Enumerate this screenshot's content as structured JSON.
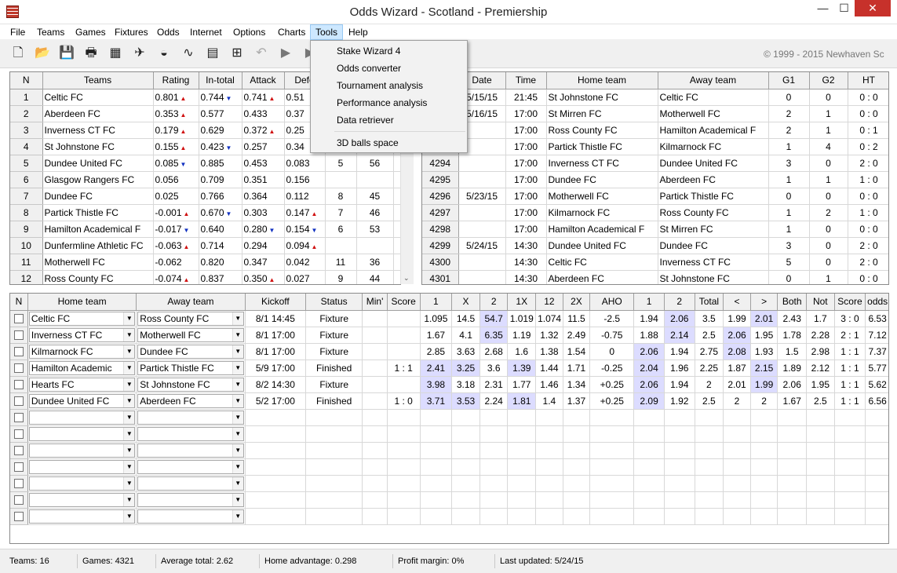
{
  "window": {
    "title": "Odds Wizard - Scotland - Premiership",
    "min": "—",
    "max": "☐",
    "close": "✕"
  },
  "menu": [
    "File",
    "Teams",
    "Games",
    "Fixtures",
    "Odds",
    "Internet",
    "Options",
    "Charts",
    "Tools",
    "Help"
  ],
  "tools_menu": [
    "Stake Wizard 4",
    "Odds converter",
    "Tournament analysis",
    "Performance analysis",
    "Data retriever",
    "3D balls space"
  ],
  "copyright": "© 1999 - 2015 Newhaven Sc",
  "teams_table": {
    "headers": [
      "N",
      "Teams",
      "Rating",
      "In-total",
      "Attack",
      "Defe"
    ],
    "rows": [
      {
        "n": "1",
        "team": "Celtic FC",
        "rating": "0.801",
        "r_ind": "up",
        "intotal": "0.744",
        "i_ind": "dn",
        "attack": "0.741",
        "a_ind": "up",
        "def": "0.51",
        "d_ind": "",
        "x": "",
        "y": ""
      },
      {
        "n": "2",
        "team": "Aberdeen FC",
        "rating": "0.353",
        "r_ind": "up",
        "intotal": "0.577",
        "i_ind": "",
        "attack": "0.433",
        "a_ind": "",
        "def": "0.37",
        "d_ind": "",
        "x": "",
        "y": ""
      },
      {
        "n": "3",
        "team": "Inverness CT FC",
        "rating": "0.179",
        "r_ind": "up",
        "intotal": "0.629",
        "i_ind": "",
        "attack": "0.372",
        "a_ind": "up",
        "def": "0.25",
        "d_ind": "",
        "x": "",
        "y": ""
      },
      {
        "n": "4",
        "team": "St Johnstone FC",
        "rating": "0.155",
        "r_ind": "up",
        "intotal": "0.423",
        "i_ind": "dn",
        "attack": "0.257",
        "a_ind": "",
        "def": "0.34",
        "d_ind": "",
        "x": "",
        "y": ""
      },
      {
        "n": "5",
        "team": "Dundee United FC",
        "rating": "0.085",
        "r_ind": "dn",
        "intotal": "0.885",
        "i_ind": "",
        "attack": "0.453",
        "a_ind": "",
        "def": "0.083",
        "d_ind": "",
        "x": "5",
        "y": "56"
      },
      {
        "n": "6",
        "team": "Glasgow Rangers FC",
        "rating": "0.056",
        "r_ind": "",
        "intotal": "0.709",
        "i_ind": "",
        "attack": "0.351",
        "a_ind": "",
        "def": "0.156",
        "d_ind": "",
        "x": "",
        "y": ""
      },
      {
        "n": "7",
        "team": "Dundee FC",
        "rating": "0.025",
        "r_ind": "",
        "intotal": "0.766",
        "i_ind": "",
        "attack": "0.364",
        "a_ind": "",
        "def": "0.112",
        "d_ind": "",
        "x": "8",
        "y": "45"
      },
      {
        "n": "8",
        "team": "Partick Thistle FC",
        "rating": "-0.001",
        "r_ind": "up",
        "intotal": "0.670",
        "i_ind": "dn",
        "attack": "0.303",
        "a_ind": "",
        "def": "0.147",
        "d_ind": "up",
        "x": "7",
        "y": "46"
      },
      {
        "n": "9",
        "team": "Hamilton Academical F",
        "rating": "-0.017",
        "r_ind": "dn",
        "intotal": "0.640",
        "i_ind": "",
        "attack": "0.280",
        "a_ind": "dn",
        "def": "0.154",
        "d_ind": "dn",
        "x": "6",
        "y": "53"
      },
      {
        "n": "10",
        "team": "Dunfermline Athletic FC",
        "rating": "-0.063",
        "r_ind": "up",
        "intotal": "0.714",
        "i_ind": "",
        "attack": "0.294",
        "a_ind": "",
        "def": "0.094",
        "d_ind": "up",
        "x": "",
        "y": ""
      },
      {
        "n": "11",
        "team": "Motherwell FC",
        "rating": "-0.062",
        "r_ind": "",
        "intotal": "0.820",
        "i_ind": "",
        "attack": "0.347",
        "a_ind": "",
        "def": "0.042",
        "d_ind": "",
        "x": "11",
        "y": "36"
      },
      {
        "n": "12",
        "team": "Ross County FC",
        "rating": "-0.074",
        "r_ind": "up",
        "intotal": "0.837",
        "i_ind": "",
        "attack": "0.350",
        "a_ind": "up",
        "def": "0.027",
        "d_ind": "",
        "x": "9",
        "y": "44"
      }
    ]
  },
  "games_table": {
    "headers": [
      "",
      "Date",
      "Time",
      "Home team",
      "Away team",
      "G1",
      "G2",
      "HT"
    ],
    "rows": [
      {
        "n": "",
        "date": "5/15/15",
        "time": "21:45",
        "home": "St Johnstone FC",
        "away": "Celtic FC",
        "g1": "0",
        "g2": "0",
        "ht": "0 : 0"
      },
      {
        "n": "",
        "date": "5/16/15",
        "time": "17:00",
        "home": "St Mirren FC",
        "away": "Motherwell FC",
        "g1": "2",
        "g2": "1",
        "ht": "0 : 0"
      },
      {
        "n": "",
        "date": "",
        "time": "17:00",
        "home": "Ross County FC",
        "away": "Hamilton Academical F",
        "g1": "2",
        "g2": "1",
        "ht": "0 : 1"
      },
      {
        "n": "",
        "date": "",
        "time": "17:00",
        "home": "Partick Thistle FC",
        "away": "Kilmarnock FC",
        "g1": "1",
        "g2": "4",
        "ht": "0 : 2"
      },
      {
        "n": "4294",
        "date": "",
        "time": "17:00",
        "home": "Inverness CT FC",
        "away": "Dundee United FC",
        "g1": "3",
        "g2": "0",
        "ht": "2 : 0"
      },
      {
        "n": "4295",
        "date": "",
        "time": "17:00",
        "home": "Dundee FC",
        "away": "Aberdeen FC",
        "g1": "1",
        "g2": "1",
        "ht": "1 : 0"
      },
      {
        "n": "4296",
        "date": "5/23/15",
        "time": "17:00",
        "home": "Motherwell FC",
        "away": "Partick Thistle FC",
        "g1": "0",
        "g2": "0",
        "ht": "0 : 0"
      },
      {
        "n": "4297",
        "date": "",
        "time": "17:00",
        "home": "Kilmarnock FC",
        "away": "Ross County FC",
        "g1": "1",
        "g2": "2",
        "ht": "1 : 0"
      },
      {
        "n": "4298",
        "date": "",
        "time": "17:00",
        "home": "Hamilton Academical F",
        "away": "St Mirren FC",
        "g1": "1",
        "g2": "0",
        "ht": "0 : 0"
      },
      {
        "n": "4299",
        "date": "5/24/15",
        "time": "14:30",
        "home": "Dundee United FC",
        "away": "Dundee FC",
        "g1": "3",
        "g2": "0",
        "ht": "2 : 0"
      },
      {
        "n": "4300",
        "date": "",
        "time": "14:30",
        "home": "Celtic FC",
        "away": "Inverness CT FC",
        "g1": "5",
        "g2": "0",
        "ht": "2 : 0"
      },
      {
        "n": "4301",
        "date": "",
        "time": "14:30",
        "home": "Aberdeen FC",
        "away": "St Johnstone FC",
        "g1": "0",
        "g2": "1",
        "ht": "0 : 0"
      }
    ]
  },
  "fixtures_table": {
    "headers": [
      "N",
      "Home team",
      "Away team",
      "Kickoff",
      "Status",
      "Min'",
      "Score",
      "1",
      "X",
      "2",
      "1X",
      "12",
      "2X",
      "AHO",
      "1",
      "2",
      "Total",
      "<",
      ">",
      "Both",
      "Not",
      "Score",
      "odds"
    ],
    "rows": [
      {
        "home": "Celtic FC",
        "away": "Ross County FC",
        "kickoff": "8/1 14:45",
        "status": "Fixture",
        "min": "",
        "score": "",
        "c1": "1.095",
        "cx": "14.5",
        "c2": "54.7",
        "c1x": "1.019",
        "c12": "1.074",
        "c2x": "11.5",
        "aho": "-2.5",
        "h1": "1.94",
        "h2": "2.06",
        "total": "3.5",
        "lt": "1.99",
        "gt": "2.01",
        "both": "2.43",
        "not": "1.7",
        "score2": "3 : 0",
        "odds": "6.53"
      },
      {
        "home": "Inverness CT FC",
        "away": "Motherwell FC",
        "kickoff": "8/1 17:00",
        "status": "Fixture",
        "min": "",
        "score": "",
        "c1": "1.67",
        "cx": "4.1",
        "c2": "6.35",
        "c1x": "1.19",
        "c12": "1.32",
        "c2x": "2.49",
        "aho": "-0.75",
        "h1": "1.88",
        "h2": "2.14",
        "total": "2.5",
        "lt": "2.06",
        "gt": "1.95",
        "both": "1.78",
        "not": "2.28",
        "score2": "2 : 1",
        "odds": "7.12"
      },
      {
        "home": "Kilmarnock FC",
        "away": "Dundee FC",
        "kickoff": "8/1 17:00",
        "status": "Fixture",
        "min": "",
        "score": "",
        "c1": "2.85",
        "cx": "3.63",
        "c2": "2.68",
        "c1x": "1.6",
        "c12": "1.38",
        "c2x": "1.54",
        "aho": "0",
        "h1": "2.06",
        "h2": "1.94",
        "total": "2.75",
        "lt": "2.08",
        "gt": "1.93",
        "both": "1.5",
        "not": "2.98",
        "score2": "1 : 1",
        "odds": "7.37"
      },
      {
        "home": "Hamilton Academic",
        "away": "Partick Thistle FC",
        "kickoff": "5/9 17:00",
        "status": "Finished",
        "min": "",
        "score": "1 : 1",
        "c1": "2.41",
        "cx": "3.25",
        "c2": "3.6",
        "c1x": "1.39",
        "c12": "1.44",
        "c2x": "1.71",
        "aho": "-0.25",
        "h1": "2.04",
        "h2": "1.96",
        "total": "2.25",
        "lt": "1.87",
        "gt": "2.15",
        "both": "1.89",
        "not": "2.12",
        "score2": "1 : 1",
        "odds": "5.77"
      },
      {
        "home": "Hearts FC",
        "away": "St Johnstone FC",
        "kickoff": "8/2 14:30",
        "status": "Fixture",
        "min": "",
        "score": "",
        "c1": "3.98",
        "cx": "3.18",
        "c2": "2.31",
        "c1x": "1.77",
        "c12": "1.46",
        "c2x": "1.34",
        "aho": "+0.25",
        "h1": "2.06",
        "h2": "1.94",
        "total": "2",
        "lt": "2.01",
        "gt": "1.99",
        "both": "2.06",
        "not": "1.95",
        "score2": "1 : 1",
        "odds": "5.62"
      },
      {
        "home": "Dundee United FC",
        "away": "Aberdeen FC",
        "kickoff": "5/2 17:00",
        "status": "Finished",
        "min": "",
        "score": "1 : 0",
        "c1": "3.71",
        "cx": "3.53",
        "c2": "2.24",
        "c1x": "1.81",
        "c12": "1.4",
        "c2x": "1.37",
        "aho": "+0.25",
        "h1": "2.09",
        "h2": "1.92",
        "total": "2.5",
        "lt": "2",
        "gt": "2",
        "both": "1.67",
        "not": "2.5",
        "score2": "1 : 1",
        "odds": "6.56"
      }
    ],
    "highlight": [
      [
        "c2",
        "h2",
        "gt"
      ],
      [
        "c2",
        "h2",
        "lt"
      ],
      [
        "h1",
        "lt"
      ],
      [
        "c1",
        "cx",
        "c1x",
        "h1",
        "gt"
      ],
      [
        "c1",
        "h1",
        "gt"
      ],
      [
        "c1",
        "cx",
        "c1x",
        "h1"
      ]
    ]
  },
  "status": [
    "Teams: 16",
    "Games: 4321",
    "Average total: 2.62",
    "Home advantage: 0.298",
    "Profit margin: 0%",
    "Last updated: 5/24/15"
  ],
  "colors": {
    "highlight": "#dcdcff",
    "close_button": "#c7312b",
    "up_arrow": "#d01010",
    "down_arrow": "#1030c0"
  }
}
